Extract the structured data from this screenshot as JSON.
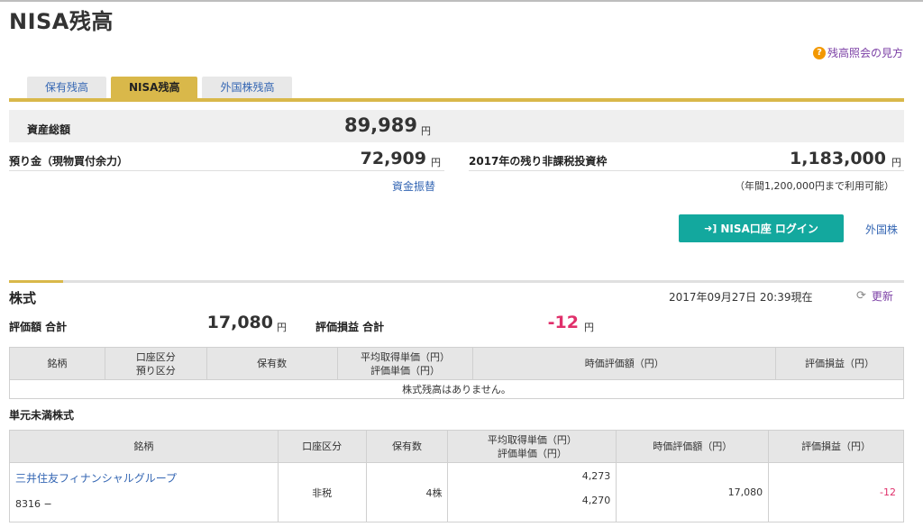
{
  "page": {
    "title": "NISA残高",
    "help_link": "残高照会の見方",
    "help_icon": "?"
  },
  "tabs": [
    {
      "label": "保有残高",
      "active": false
    },
    {
      "label": "NISA残高",
      "active": true
    },
    {
      "label": "外国株残高",
      "active": false
    }
  ],
  "summary": {
    "total_assets_label": "資産総額",
    "total_assets_value": "89,989",
    "yen": "円",
    "deposit_label": "預り金（現物買付余力）",
    "deposit_value": "72,909",
    "transfer_link": "資金振替",
    "remaining_label": "2017年の残り非課税投資枠",
    "remaining_value": "1,183,000",
    "remaining_note": "（年間1,200,000円まで利用可能）"
  },
  "actions": {
    "nisa_login": "NISA口座 ログイン",
    "foreign_link": "外国株"
  },
  "stocks_section": {
    "title": "株式",
    "as_of": "2017年09月27日 20:39現在",
    "refresh": "更新",
    "valuation_total_label": "評価額 合計",
    "valuation_total_value": "17,080",
    "pl_total_label": "評価損益 合計",
    "pl_total_value": "-12",
    "columns": {
      "name": "銘柄",
      "account_1": "口座区分",
      "account_2": "預り区分",
      "qty": "保有数",
      "cost_1": "平均取得単価（円）",
      "cost_2": "評価単価（円）",
      "market": "時価評価額（円）",
      "pl": "評価損益（円）"
    },
    "empty_message": "株式残高はありません。"
  },
  "odd_lot_section": {
    "title": "単元未満株式",
    "columns": {
      "name": "銘柄",
      "account": "口座区分",
      "qty": "保有数",
      "cost_1": "平均取得単価（円）",
      "cost_2": "評価単価（円）",
      "market": "時価評価額（円）",
      "pl": "評価損益（円）"
    },
    "rows": [
      {
        "name": "三井住友フィナンシャルグループ",
        "code": "8316 −",
        "account": "非税",
        "qty": "4株",
        "avg_cost": "4,273",
        "eval_price": "4,270",
        "market_value": "17,080",
        "pl": "-12"
      }
    ]
  },
  "colors": {
    "accent_gold": "#d9b84a",
    "button_teal": "#13a89e",
    "link_blue": "#3466b3",
    "negative_pink": "#e0306b"
  }
}
